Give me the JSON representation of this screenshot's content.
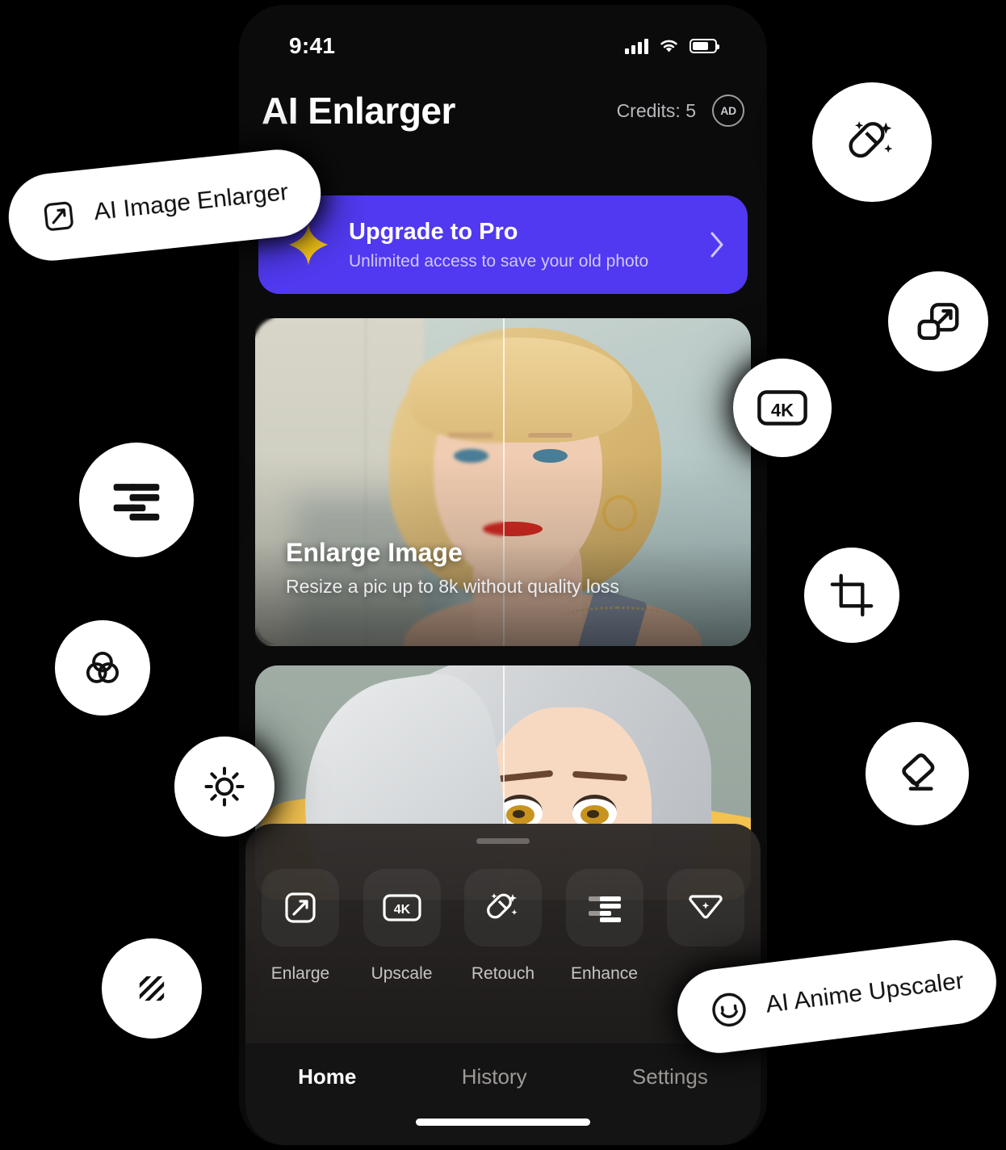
{
  "status_bar": {
    "time": "9:41",
    "signal_icon": "cellular-signal-icon",
    "wifi_icon": "wifi-icon",
    "battery_icon": "battery-icon"
  },
  "header": {
    "app_title": "AI Enlarger",
    "credits_label": "Credits: 5",
    "ad_badge_label": "AD"
  },
  "promo_banner": {
    "title": "Upgrade to Pro",
    "subtitle": "Unlimited access to save your old photo",
    "star_icon": "sparkle-star-icon",
    "chevron_icon": "chevron-right-icon",
    "accent_color": "#5039f0",
    "star_color": "#f5c518"
  },
  "cards": [
    {
      "name": "enlarge-image-card",
      "title": "Enlarge Image",
      "subtitle": "Resize a pic up to 8k without quality loss",
      "comparison_slider": true
    },
    {
      "name": "anime-upscale-card",
      "title": "",
      "subtitle": "",
      "comparison_slider": true
    }
  ],
  "tool_dock": {
    "grab_handle": "drag-handle",
    "tools": [
      {
        "label": "Enlarge",
        "icon": "expand-arrow-square-icon"
      },
      {
        "label": "Upscale",
        "icon": "4k-badge-icon"
      },
      {
        "label": "Retouch",
        "icon": "capsule-sparkle-icon"
      },
      {
        "label": "Enhance",
        "icon": "sliders-bars-icon"
      },
      {
        "label": "",
        "icon": "filter-funnel-sparkle-icon"
      }
    ]
  },
  "tab_bar": {
    "tabs": [
      {
        "label": "Home",
        "active": true
      },
      {
        "label": "History",
        "active": false
      },
      {
        "label": "Settings",
        "active": false
      }
    ],
    "home_indicator": "home-indicator"
  },
  "floating_badges": {
    "pills": [
      {
        "label": "AI Image Enlarger",
        "icon": "expand-arrow-square-icon"
      },
      {
        "label": "AI Anime Upscaler",
        "icon": "smiley-face-icon"
      }
    ],
    "circles": [
      {
        "icon": "capsule-sparkle-icon"
      },
      {
        "icon": "resize-squares-arrow-icon"
      },
      {
        "icon": "4k-badge-icon",
        "label": "4K"
      },
      {
        "icon": "crop-icon"
      },
      {
        "icon": "eraser-icon"
      },
      {
        "icon": "sliders-bars-icon"
      },
      {
        "icon": "color-circles-icon"
      },
      {
        "icon": "brightness-sun-icon"
      },
      {
        "icon": "diagonal-stripes-texture-icon"
      }
    ]
  },
  "colors": {
    "background": "#000000",
    "phone_body": "#0b0b0c",
    "accent": "#5039f0",
    "badge_white": "#ffffff"
  }
}
